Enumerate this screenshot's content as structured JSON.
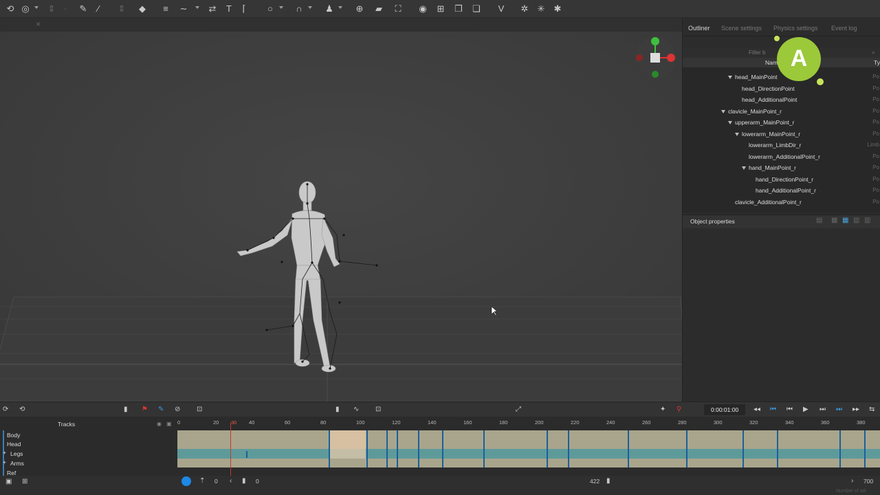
{
  "right_panel": {
    "tabs": [
      "Outliner",
      "Scene settings",
      "Physics settings",
      "Event log"
    ],
    "filter_placeholder": "Filter b",
    "column_name": "Nam",
    "column_type": "Ty",
    "tree": [
      {
        "label": "head_MainPoint",
        "type": "Po"
      },
      {
        "label": "head_DirectionPoint",
        "type": "Po"
      },
      {
        "label": "head_AdditionalPoint",
        "type": "Po"
      },
      {
        "label": "clavicle_MainPoint_r",
        "type": "Po"
      },
      {
        "label": "upperarm_MainPoint_r",
        "type": "Po"
      },
      {
        "label": "lowerarm_MainPoint_r",
        "type": "Po"
      },
      {
        "label": "lowerarm_LimbDir_r",
        "type": "Limb"
      },
      {
        "label": "lowerarm_AdditionalPoint_r",
        "type": "Po"
      },
      {
        "label": "hand_MainPoint_r",
        "type": "Po"
      },
      {
        "label": "hand_DirectionPoint_r",
        "type": "Po"
      },
      {
        "label": "hand_AdditionalPoint_r",
        "type": "Po"
      },
      {
        "label": "clavicle_AdditionalPoint_r",
        "type": "Po"
      }
    ],
    "object_properties_label": "Object properties"
  },
  "badge": {
    "letter": "A",
    "color": "#9bc93a"
  },
  "timeline": {
    "tracks_header": "Tracks",
    "tracks": [
      "Body",
      "Head",
      "Legs",
      "Arms",
      "Ref"
    ],
    "ruler": [
      "0",
      "20",
      "30",
      "40",
      "60",
      "80",
      "100",
      "120",
      "140",
      "160",
      "180",
      "200",
      "220",
      "240",
      "260",
      "280",
      "300",
      "320",
      "340",
      "360",
      "380"
    ],
    "time_display": "0:00:01:00",
    "current_frame": "30"
  },
  "bottom": {
    "start_frame": "0",
    "range_start": "0",
    "range_end": "422",
    "end_frame": "700",
    "footer_hint": "Number of sel"
  },
  "colors": {
    "accent_blue": "#1e88e5",
    "keyframe": "#1b5f9a",
    "track_tan": "#a9a58c",
    "track_teal": "#5e9a9a",
    "playhead": "#c0392b"
  }
}
